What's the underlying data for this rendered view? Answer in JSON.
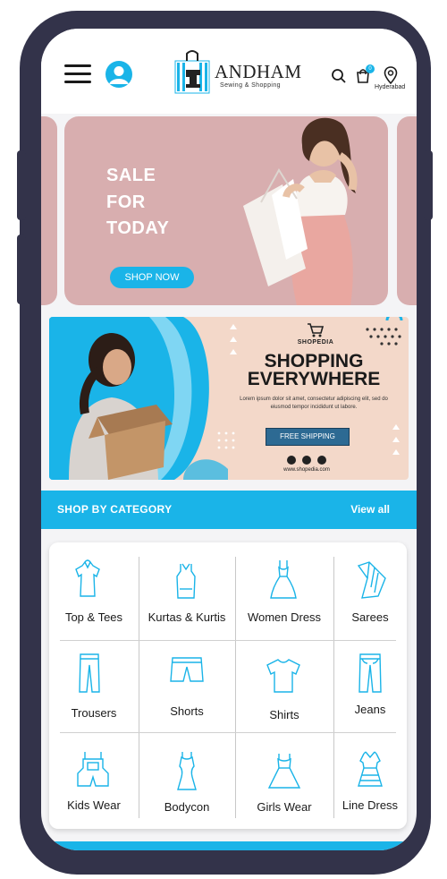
{
  "header": {
    "brand": "ANDHAM",
    "tagline": "Sewing & Shopping",
    "cart_count": "0",
    "location": "Hyderabad"
  },
  "hero": {
    "line1": "SALE",
    "line2": "FOR",
    "line3": "TODAY",
    "cta": "SHOP NOW"
  },
  "promo": {
    "brand": "SHOPEDIA",
    "headline1": "SHOPPING",
    "headline2": "EVERYWHERE",
    "body": "Lorem ipsum dolor sit amet, consectetur adipiscing elit, sed do eiusmod tempor incididunt ut labore.",
    "cta": "FREE SHIPPING",
    "url": "www.shopedia.com"
  },
  "categories": {
    "title": "SHOP BY CATEGORY",
    "view_all": "View all",
    "items": [
      {
        "label": "Top & Tees",
        "icon": "top-icon"
      },
      {
        "label": "Kurtas & Kurtis",
        "icon": "kurta-icon"
      },
      {
        "label": "Women Dress",
        "icon": "dress-icon"
      },
      {
        "label": "Sarees",
        "icon": "saree-icon"
      },
      {
        "label": "Trousers",
        "icon": "trousers-icon"
      },
      {
        "label": "Shorts",
        "icon": "shorts-icon"
      },
      {
        "label": "Shirts",
        "icon": "shirt-icon"
      },
      {
        "label": "Jeans",
        "icon": "jeans-icon"
      },
      {
        "label": "Kids Wear",
        "icon": "kids-wear-icon"
      },
      {
        "label": "Bodycon",
        "icon": "bodycon-icon"
      },
      {
        "label": "Girls Wear",
        "icon": "girls-wear-icon"
      },
      {
        "label": "Line Dress",
        "icon": "line-dress-icon"
      }
    ]
  },
  "colors": {
    "accent": "#1ab4e8",
    "frame": "#33334a",
    "hero_bg": "#d8aeaf",
    "promo_bg": "#f3d8c9"
  }
}
